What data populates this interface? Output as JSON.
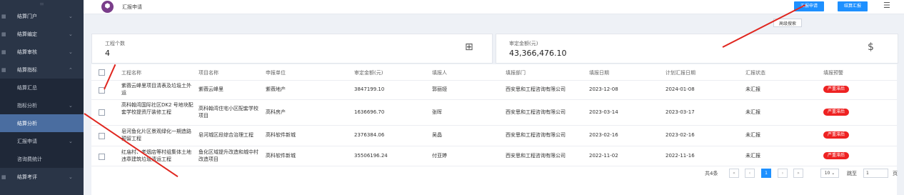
{
  "sidebar": {
    "top_icon": "≡",
    "items": [
      {
        "label": "结算门户",
        "caret": "⌄",
        "icon": "grid-icon"
      },
      {
        "label": "结算编定",
        "caret": "⌄",
        "icon": "grid-icon"
      },
      {
        "label": "结算审核",
        "caret": "⌄",
        "icon": "grid-icon"
      },
      {
        "label": "结算指标",
        "caret": "⌃",
        "icon": "grid-icon"
      }
    ],
    "sub_items": [
      {
        "label": "结算汇总",
        "caret": ""
      },
      {
        "label": "指标分析",
        "caret": "⌄"
      },
      {
        "label": "结算分析",
        "caret": "",
        "active": true
      },
      {
        "label": "汇报申请",
        "caret": "⌄"
      },
      {
        "label": "咨询费统计",
        "caret": ""
      }
    ],
    "bottom_item": {
      "label": "结算考评",
      "caret": "⌄"
    }
  },
  "header": {
    "title": "汇报申请",
    "buttons": {
      "apply": "汇报申请",
      "report": "结算汇报"
    },
    "menu_icon": "☰",
    "advanced_search": "高级搜索"
  },
  "stats": {
    "count_label": "工程个数",
    "count_value": "4",
    "amount_label": "审定金额(元)",
    "amount_value": "43,366,476.10"
  },
  "table": {
    "columns": [
      "工程名称",
      "项目名称",
      "申报单位",
      "审定金额(元)",
      "填报人",
      "填报部门",
      "填报日期",
      "计划汇报日期",
      "汇报状态",
      "填报预警"
    ],
    "rows": [
      {
        "name": "紫薇云峰里项目清表及垃圾土外运",
        "project": "紫薇云峰里",
        "unit": "紫薇地产",
        "amount": "3847199.10",
        "person": "郭丽娅",
        "dept": "西安思和工程咨询有限公司",
        "date": "2023-12-08",
        "plan": "2024-01-08",
        "status": "未汇报",
        "warn": "严重滞后"
      },
      {
        "name": "高科翰湾国际社区DK2 号地块配套学校提资厅装修工程",
        "project": "高科翰湾住宅小区配套学校项目",
        "unit": "高科房产",
        "amount": "1636696.70",
        "person": "张晖",
        "dept": "西安思和工程咨询有限公司",
        "date": "2023-03-14",
        "plan": "2023-03-17",
        "status": "未汇报",
        "warn": "严重滞后"
      },
      {
        "name": "皂河鱼化片区景观绿化一期造路预留工程",
        "project": "皂河城区段综合治理工程",
        "unit": "高科软件新城",
        "amount": "2376384.06",
        "person": "吴晶",
        "dept": "西安思和工程咨询有限公司",
        "date": "2023-02-16",
        "plan": "2023-02-16",
        "status": "未汇报",
        "warn": "严重滞后"
      },
      {
        "name": "红庙村、老烟店等村组集体土地违章建筑垃圾清运工程",
        "project": "鱼化区域提升改造和城中村改造项目",
        "unit": "高科软件新城",
        "amount": "35506196.24",
        "person": "付亚婷",
        "dept": "西安思和工程咨询有限公司",
        "date": "2022-11-02",
        "plan": "2022-11-16",
        "status": "未汇报",
        "warn": "严重滞后"
      }
    ]
  },
  "pager": {
    "total": "共4条",
    "first": "«",
    "prev": "‹",
    "current": "1",
    "next": "›",
    "last": "»",
    "size": "10 ⌄",
    "goto": "跳至",
    "page_value": "1",
    "page_suffix": "页"
  },
  "colors": {
    "accent": "#1e90ff",
    "sidebar": "#2a3547",
    "danger": "#ee2222",
    "annotation": "#e0261f"
  }
}
